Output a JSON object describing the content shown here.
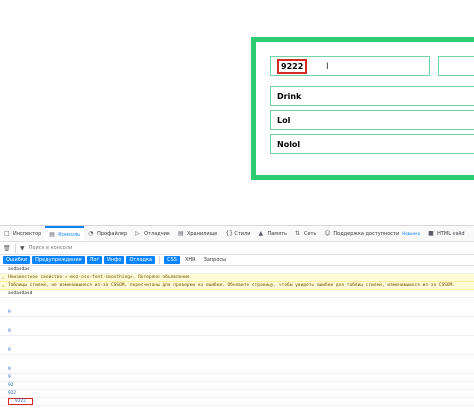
{
  "app": {
    "input_value": "9222",
    "add_button": "",
    "list_items": [
      "Drink",
      "Lol",
      "Nolol"
    ],
    "colors": {
      "frame": "#2ecc71",
      "highlight": "#d62828",
      "accent": "#0a84ff"
    }
  },
  "devtools": {
    "tabs": [
      {
        "label": "Инспектор",
        "icon": "inspector-icon"
      },
      {
        "label": "Консоль",
        "icon": "console-icon"
      },
      {
        "label": "Профайлер",
        "icon": "profiler-icon"
      },
      {
        "label": "Отладчик",
        "icon": "debugger-icon"
      },
      {
        "label": "Хранилище",
        "icon": "storage-icon"
      },
      {
        "label": "Стили",
        "icon": "styles-icon"
      },
      {
        "label": "Память",
        "icon": "memory-icon"
      },
      {
        "label": "Сеть",
        "icon": "network-icon"
      },
      {
        "label": "Поддержка доступности",
        "icon": "accessibility-icon",
        "badge": "Новинка"
      },
      {
        "label": "HTML valid",
        "icon": "html-valid-icon"
      }
    ],
    "filter_placeholder": "Поиск в консоли",
    "levels": [
      "Ошибки",
      "Предупреждения",
      "Лог",
      "Инфо",
      "Отладка"
    ],
    "types": [
      "CSS",
      "XHR",
      "Запросы"
    ],
    "messages": [
      "asdasdas",
      "Неизвестное свойство «-moz-osx-font-smoothing».  Потеряно объявление.",
      "Таблицы стилей, не изменившиеся из-за CSSOM, пересчитаны для проверки на ошибки. Обновите страницу, чтобы увидеть ошибки для таблиц стилей, изменившихся из-за CSSOM.",
      "asdasdasd",
      "9",
      "9",
      "9",
      "9",
      "9",
      "92",
      "922"
    ],
    "last_message": "9222"
  }
}
